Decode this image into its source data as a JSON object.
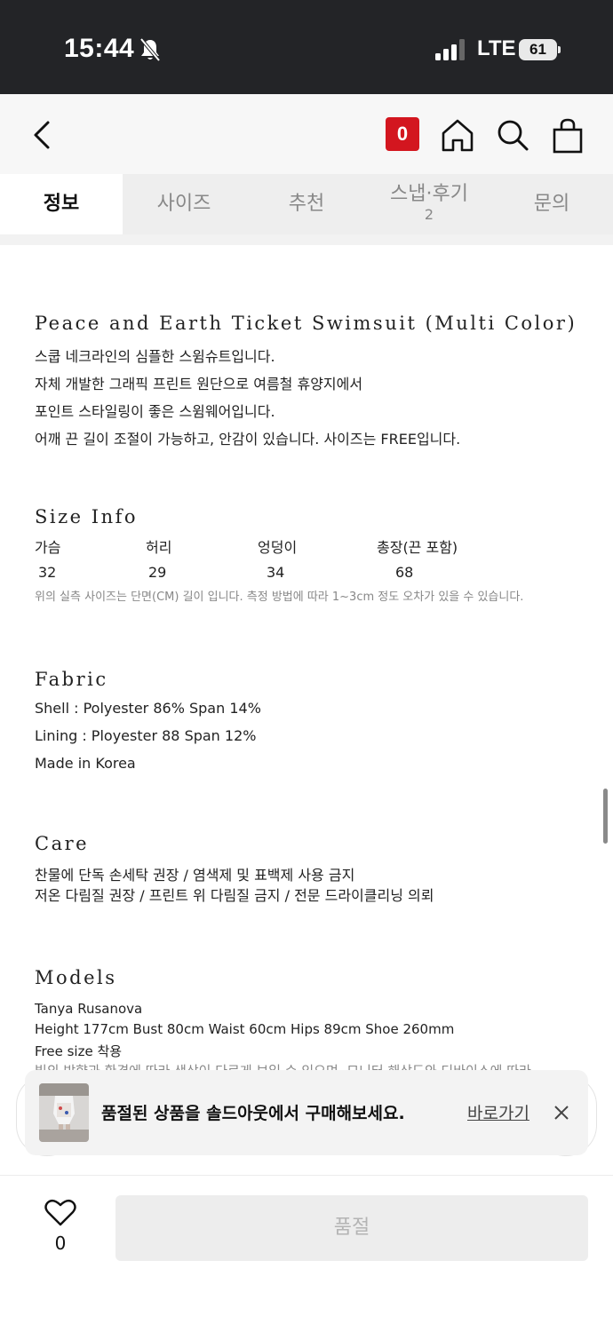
{
  "status_bar": {
    "time": "15:44",
    "network": "LTE",
    "battery": "61"
  },
  "header": {
    "cart_count": "0"
  },
  "tabs": [
    {
      "label": "정보"
    },
    {
      "label": "사이즈"
    },
    {
      "label": "추천"
    },
    {
      "label": "스냅·후기",
      "count": "2"
    },
    {
      "label": "문의"
    }
  ],
  "description": {
    "title": "Peace and Earth Ticket Swimsuit (Multi Color)",
    "lines": [
      "스쿱 네크라인의 심플한 스윔슈트입니다.",
      "자체 개발한 그래픽 프린트 원단으로 여름철 휴양지에서",
      "포인트 스타일링이 좋은 스윔웨어입니다.",
      "어깨 끈 길이 조절이 가능하고, 안감이 있습니다. 사이즈는 FREE입니다."
    ]
  },
  "size_info": {
    "title": "Size Info",
    "headers": [
      "가슴",
      "허리",
      "엉덩이",
      "총장(끈 포함)"
    ],
    "values": [
      "32",
      "29",
      "34",
      "68"
    ],
    "note": "위의 실측 사이즈는 단면(CM) 길이 입니다. 측정 방법에 따라 1~3cm 정도 오차가 있을 수 있습니다."
  },
  "fabric": {
    "title": "Fabric",
    "lines": [
      "Shell : Polyester 86% Span 14%",
      "Lining : Ployester 88 Span 12%",
      "Made in Korea"
    ]
  },
  "care": {
    "title": "Care",
    "lines": [
      "찬물에 단독 손세탁 권장 / 염색제 및 표백제 사용 금지",
      "저온 다림질 권장 / 프린트 위 다림질 금지 / 전문 드라이클리닝 의뢰"
    ]
  },
  "models": {
    "title": "Models",
    "lines": [
      "Tanya Rusanova",
      "Height 177cm Bust 80cm Waist 60cm Hips 89cm Shoe 260mm",
      "Free size 착용",
      "빛의 방향과 환경에 따라 색상이 다르게 보일 수 있으며, 모니터 해상도와 디바이스에 따라"
    ]
  },
  "toast": {
    "message": "품절된 상품을 솔드아웃에서 구매해보세요.",
    "link": "바로가기"
  },
  "bottom_bar": {
    "like_count": "0",
    "button_label": "품절"
  },
  "colors": {
    "accent": "#d3161f",
    "status_bar": "#232427"
  }
}
